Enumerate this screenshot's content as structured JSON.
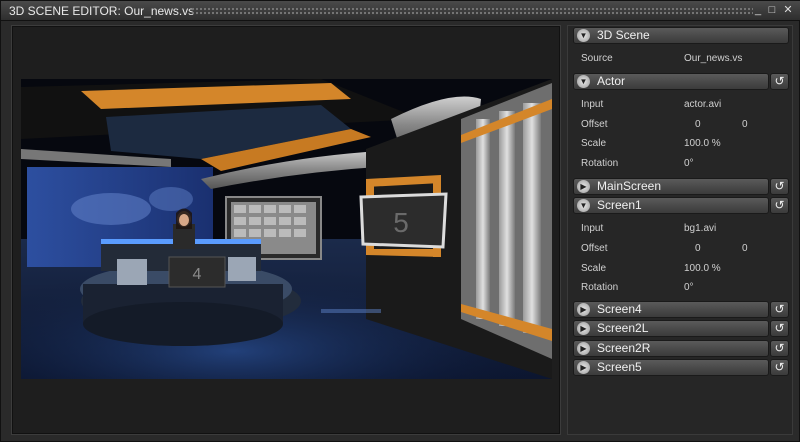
{
  "window": {
    "title": "3D SCENE EDITOR: Our_news.vs",
    "minimize_icon": "minimize-icon",
    "maximize_icon": "maximize-icon",
    "close_icon": "close-icon",
    "minimize_glyph": "_",
    "maximize_glyph": "□",
    "close_glyph": "✕"
  },
  "viewport": {
    "screen4_text": "4",
    "screen5_text": "5"
  },
  "panel": {
    "scene": {
      "label": "3D Scene",
      "source_label": "Source",
      "source_value": "Our_news.vs"
    },
    "actor": {
      "label": "Actor",
      "input_label": "Input",
      "input_value": "actor.avi",
      "offset_label": "Offset",
      "offset_x": "0",
      "offset_y": "0",
      "scale_label": "Scale",
      "scale_value": "100.0 %",
      "rotation_label": "Rotation",
      "rotation_value": "0°"
    },
    "mainscreen": {
      "label": "MainScreen"
    },
    "screen1": {
      "label": "Screen1",
      "input_label": "Input",
      "input_value": "bg1.avi",
      "offset_label": "Offset",
      "offset_x": "0",
      "offset_y": "0",
      "scale_label": "Scale",
      "scale_value": "100.0 %",
      "rotation_label": "Rotation",
      "rotation_value": "0°"
    },
    "screen4": {
      "label": "Screen4"
    },
    "screen2l": {
      "label": "Screen2L"
    },
    "screen2r": {
      "label": "Screen2R"
    },
    "screen5": {
      "label": "Screen5"
    },
    "collapse_glyph": "▼",
    "expand_glyph": "▶",
    "reset_glyph": "↺"
  }
}
